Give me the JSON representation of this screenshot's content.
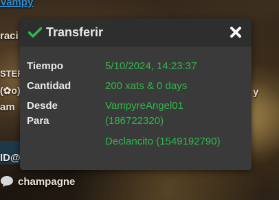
{
  "background": {
    "username": "Vampy",
    "text_raci": "raci",
    "text_ster": "STER",
    "text_co": "(✿o)",
    "text_am": "am",
    "text_y": "y",
    "text_id": "ID@",
    "chat_item": "champagne"
  },
  "dialog": {
    "title": "Transferir",
    "close_icon": "close-icon",
    "check_icon": "check-icon",
    "rows": [
      {
        "label": "Tiempo",
        "value": "5/10/2024, 14:23:37"
      },
      {
        "label": "Cantidad",
        "value": "200 xats & 0 days"
      },
      {
        "label": "Desde",
        "value": "VampyreAngel01"
      },
      {
        "label": "Para",
        "value": "(186722320)"
      },
      {
        "label": "",
        "value": "Declancito (1549192790)"
      }
    ],
    "colors": {
      "value": "#2fb84c",
      "check": "#2fb84c",
      "header": "#2e2e2e",
      "body": "#3a3a3a"
    }
  }
}
